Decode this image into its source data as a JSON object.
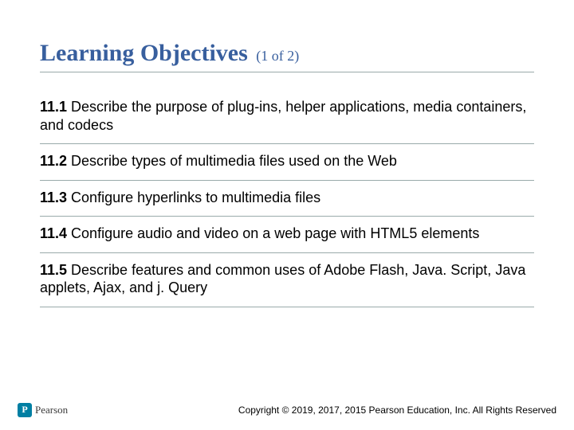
{
  "title": {
    "main": "Learning Objectives",
    "sub": "(1 of 2)"
  },
  "objectives": [
    {
      "num": "11.1",
      "text": "Describe the purpose of plug-ins, helper applications, media containers, and codecs"
    },
    {
      "num": "11.2",
      "text": "Describe types of multimedia files used on the Web"
    },
    {
      "num": "11.3",
      "text": "Configure hyperlinks to multimedia files"
    },
    {
      "num": "11.4",
      "text": "Configure audio and video on a web page with HTML5 elements"
    },
    {
      "num": "11.5",
      "text": "Describe features and common uses of Adobe Flash, Java. Script, Java applets, Ajax, and j. Query"
    }
  ],
  "footer": {
    "brand": "Pearson",
    "copyright": "Copyright © 2019, 2017, 2015 Pearson Education, Inc. All Rights Reserved"
  }
}
